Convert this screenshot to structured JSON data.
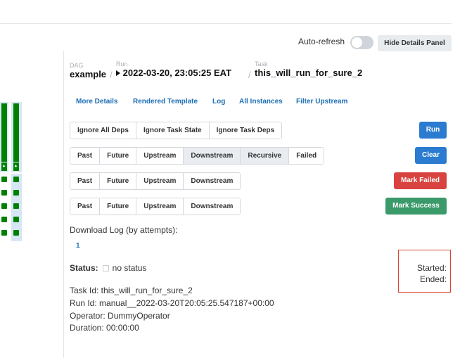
{
  "header": {
    "auto_refresh_label": "Auto-refresh",
    "hide_details_label": "Hide Details Panel"
  },
  "breadcrumb": {
    "dag_label": "DAG",
    "dag_value": "example",
    "run_label": "Run",
    "run_value": "2022-03-20, 23:05:25 EAT",
    "task_label": "Task",
    "task_value": "this_will_run_for_sure_2",
    "separator": "/"
  },
  "links": [
    "More Details",
    "Rendered Template",
    "Log",
    "All Instances",
    "Filter Upstream"
  ],
  "run_options": [
    "Ignore All Deps",
    "Ignore Task State",
    "Ignore Task Deps"
  ],
  "run_button": "Run",
  "clear_options": [
    "Past",
    "Future",
    "Upstream",
    "Downstream",
    "Recursive",
    "Failed"
  ],
  "clear_button": "Clear",
  "mark_failed_options": [
    "Past",
    "Future",
    "Upstream",
    "Downstream"
  ],
  "mark_failed_button": "Mark Failed",
  "mark_success_options": [
    "Past",
    "Future",
    "Upstream",
    "Downstream"
  ],
  "mark_success_button": "Mark Success",
  "download": {
    "label": "Download Log (by attempts):",
    "attempt": "1"
  },
  "status": {
    "key": "Status:",
    "value": "no status",
    "started": "Started:",
    "ended": "Ended:"
  },
  "details": {
    "task_id": "Task Id: this_will_run_for_sure_2",
    "run_id": "Run Id: manual__2022-03-20T20:05:25.547187+00:00",
    "operator": "Operator: DummyOperator",
    "duration": "Duration: 00:00:00"
  },
  "colors": {
    "run": "#2b7bd0",
    "clear": "#2b7bd0",
    "mark_failed": "#d9433f",
    "mark_success": "#3a9a6a",
    "task_success": "#008000",
    "highlight_box": "#d9432f"
  }
}
